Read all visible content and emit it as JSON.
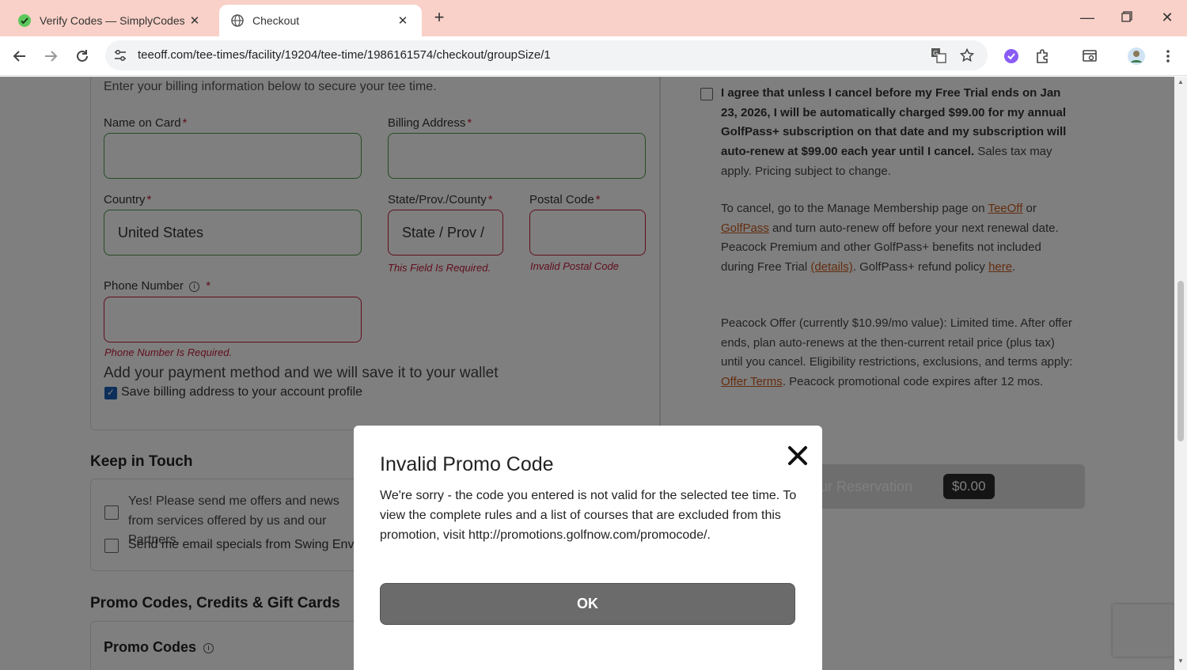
{
  "browser": {
    "tabs": [
      {
        "title": "Verify Codes — SimplyCodes",
        "active": false
      },
      {
        "title": "Checkout",
        "active": true
      }
    ],
    "url": "teeoff.com/tee-times/facility/19204/tee-time/1986161574/checkout/groupSize/1",
    "tabbar_color": "#f9d1c8"
  },
  "billing": {
    "intro": "Enter your billing information below to secure your tee time.",
    "name_on_card_label": "Name on Card",
    "billing_address_label": "Billing Address",
    "country_label": "Country",
    "country_value": "United States",
    "state_label": "State/Prov./County",
    "state_value": "State / Prov /",
    "state_error": "This Field Is Required.",
    "postal_label": "Postal Code",
    "postal_error": "Invalid Postal Code",
    "phone_label": "Phone Number",
    "phone_error": "Phone Number Is Required.",
    "required_mark": "*",
    "payment_text": "Add your payment method and we will save it to your wallet",
    "save_billing_label": "Save billing address to your account profile",
    "save_billing_checked": true
  },
  "terms": {
    "agree_bold": "I agree that unless I cancel before my Free Trial ends on Jan 23, 2026, I will be automatically charged $99.00 for my annual GolfPass+ subscription on that date and my subscription will auto-renew at $99.00 each year until I cancel.",
    "agree_rest": " Sales tax may apply. Pricing subject to change.",
    "cancel_p1": "To cancel, go to the Manage Membership page on ",
    "teeoff_link": "TeeOff",
    "or_text": " or ",
    "golfpass_link": "GolfPass",
    "cancel_p2": " and turn auto-renew off before your next renewal date. Peacock Premium and other GolfPass+ benefits not included during Free Trial ",
    "details_link": "(details)",
    "cancel_p3": ". GolfPass+ refund policy ",
    "here_link": "here",
    "cancel_p4": ".",
    "peacock_p1": "Peacock Offer (currently $10.99/mo value): Limited time. After offer ends, plan auto-renews at the then-current retail price (plus tax) until you cancel. Eligibility restrictions, exclusions, and terms apply: ",
    "offer_terms_link": "Offer Terms",
    "peacock_p2": ". Peacock promotional code expires after 12 mos."
  },
  "reserve": {
    "label": "ur Reservation",
    "price": "$0.00"
  },
  "keep_in_touch": {
    "heading": "Keep in Touch",
    "option1": "Yes! Please send me offers and news from services offered by us and our Partners.",
    "option2": "Send me email specials from Swing Envy"
  },
  "promo": {
    "heading": "Promo Codes, Credits & Gift Cards",
    "subheading": "Promo Codes"
  },
  "modal": {
    "title": "Invalid Promo Code",
    "body": "We're sorry - the code you entered is not valid for the selected tee time. To view the complete rules and a list of courses that are excluded from this promotion, visit http://promotions.golfnow.com/promocode/.",
    "ok_label": "OK"
  }
}
